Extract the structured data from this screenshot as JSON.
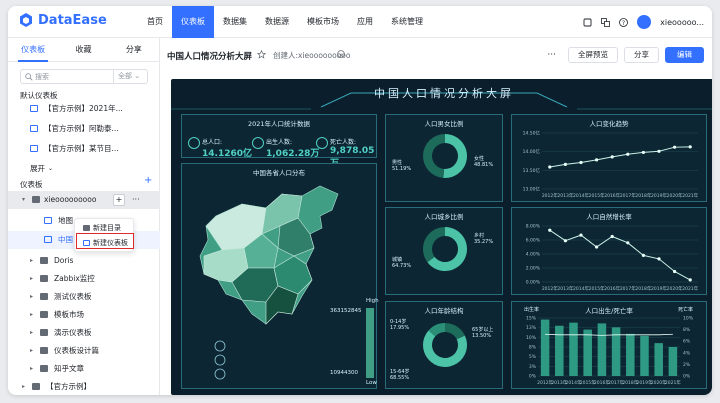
{
  "app": {
    "logo_text": "DataEase",
    "nav": [
      "首页",
      "仪表板",
      "数据集",
      "数据源",
      "模板市场",
      "应用",
      "系统管理"
    ],
    "nav_active": 1,
    "user_name": "xieooooo..."
  },
  "sidebar": {
    "tabs": [
      "仪表板",
      "收藏",
      "分享"
    ],
    "search_placeholder": "搜索",
    "search_filter": "全部",
    "default_section": "默认仪表板",
    "default_items": [
      "【官方示例】2021年...",
      "【官方示例】阿勒泰...",
      "【官方示例】某节目..."
    ],
    "expand_label": "展开",
    "dash_section": "仪表板",
    "tree": [
      {
        "label": "xieooooooooo",
        "level": 0,
        "type": "folder",
        "expanded": true
      },
      {
        "label": "地图",
        "level": 1,
        "type": "dashboard"
      },
      {
        "label": "中国",
        "level": 1,
        "type": "dashboard"
      },
      {
        "label": "Doris",
        "level": 0,
        "type": "folder"
      },
      {
        "label": "Zabbix监控",
        "level": 0,
        "type": "folder"
      },
      {
        "label": "测试仪表板",
        "level": 0,
        "type": "folder"
      },
      {
        "label": "模板市场",
        "level": 0,
        "type": "folder"
      },
      {
        "label": "演示仪表板",
        "level": 0,
        "type": "folder"
      },
      {
        "label": "仪表板设计篇",
        "level": 0,
        "type": "folder"
      },
      {
        "label": "知乎文章",
        "level": 0,
        "type": "folder"
      },
      {
        "label": "【官方示例】",
        "level": 0,
        "type": "folder"
      }
    ],
    "popup_menu": [
      "新建目录",
      "新建仪表板"
    ]
  },
  "main": {
    "title": "中国人口情况分析大屏",
    "creator": "创建人:xieooooooooo",
    "btn_fullscreen": "全屏预览",
    "btn_share": "分享",
    "btn_edit": "编辑"
  },
  "screen": {
    "title": "中国人口情况分析大屏",
    "stats_title": "2021年人口统计数据",
    "kpis": [
      {
        "label": "总人口:",
        "value": "14.1260亿"
      },
      {
        "label": "出生人数:",
        "value": "1,062.28万"
      },
      {
        "label": "死亡人数:",
        "value": "9,878.05万"
      }
    ],
    "map_title": "中国各省人口分布",
    "map_legend_max": "363152845",
    "map_legend_min": "10944300",
    "map_legend_high": "High",
    "map_legend_low": "Low",
    "gender_title": "人口男女比例",
    "gender_labels": [
      "男性 51.19%",
      "女性 48.81%"
    ],
    "urban_title": "人口城乡比例",
    "urban_labels": [
      "城镇 64.73%",
      "乡村 35.27%"
    ],
    "age_title": "人口年龄结构",
    "age_labels": [
      "0-14岁 17.95%",
      "15-64岁 68.55%",
      "65岁以上 13.50%"
    ],
    "change_title": "人口变化趋势",
    "growth_title": "人口自然增长率",
    "birth_title": "人口出生/死亡率",
    "birth_left_axis": "出生率",
    "birth_right_axis": "死亡率"
  },
  "chart_data": [
    {
      "type": "line",
      "title": "人口变化趋势",
      "categories": [
        "2012年",
        "2013年",
        "2014年",
        "2015年",
        "2016年",
        "2017年",
        "2018年",
        "2019年",
        "2020年",
        "2021年"
      ],
      "series": [
        {
          "values": [
            13.59,
            13.66,
            13.71,
            13.78,
            13.86,
            13.93,
            13.98,
            14.01,
            14.12,
            14.13
          ]
        }
      ],
      "yticks": [
        "13.00亿",
        "13.50亿",
        "14.00亿",
        "14.50亿"
      ]
    },
    {
      "type": "line",
      "title": "人口自然增长率",
      "categories": [
        "2012年",
        "2013年",
        "2014年",
        "2015年",
        "2016年",
        "2017年",
        "2018年",
        "2019年",
        "2020年",
        "2021年"
      ],
      "series": [
        {
          "values": [
            7.4,
            5.9,
            6.7,
            5.0,
            6.5,
            5.6,
            3.8,
            3.3,
            1.5,
            0.3
          ]
        }
      ],
      "yticks": [
        "0.00%",
        "2.00%",
        "4.00%",
        "6.00%",
        "8.00%"
      ]
    },
    {
      "type": "bar",
      "title": "人口出生/死亡率",
      "categories": [
        "2012年",
        "2013年",
        "2014年",
        "2015年",
        "2016年",
        "2017年",
        "2018年",
        "2019年",
        "2020年",
        "2021年"
      ],
      "series": [
        {
          "name": "出生率",
          "values": [
            14.6,
            13.0,
            13.8,
            12.0,
            13.6,
            12.6,
            10.9,
            10.4,
            8.5,
            7.5
          ]
        },
        {
          "name": "死亡率",
          "values": [
            7.2,
            7.1,
            7.1,
            7.1,
            7.0,
            7.1,
            7.1,
            7.1,
            7.1,
            7.2
          ]
        }
      ],
      "yticks_left": [
        "0%",
        "3%",
        "5%",
        "8%",
        "10%",
        "13%",
        "15%"
      ],
      "yticks_right": [
        "0%",
        "2%",
        "4%",
        "6%",
        "8%",
        "10%"
      ]
    },
    {
      "type": "pie",
      "title": "人口男女比例",
      "categories": [
        "男性",
        "女性"
      ],
      "values": [
        51.19,
        48.81
      ]
    },
    {
      "type": "pie",
      "title": "人口城乡比例",
      "categories": [
        "城镇",
        "乡村"
      ],
      "values": [
        64.73,
        35.27
      ]
    },
    {
      "type": "pie",
      "title": "人口年龄结构",
      "categories": [
        "0-14岁",
        "15-64岁",
        "65岁以上"
      ],
      "values": [
        17.95,
        68.55,
        13.5
      ]
    }
  ]
}
